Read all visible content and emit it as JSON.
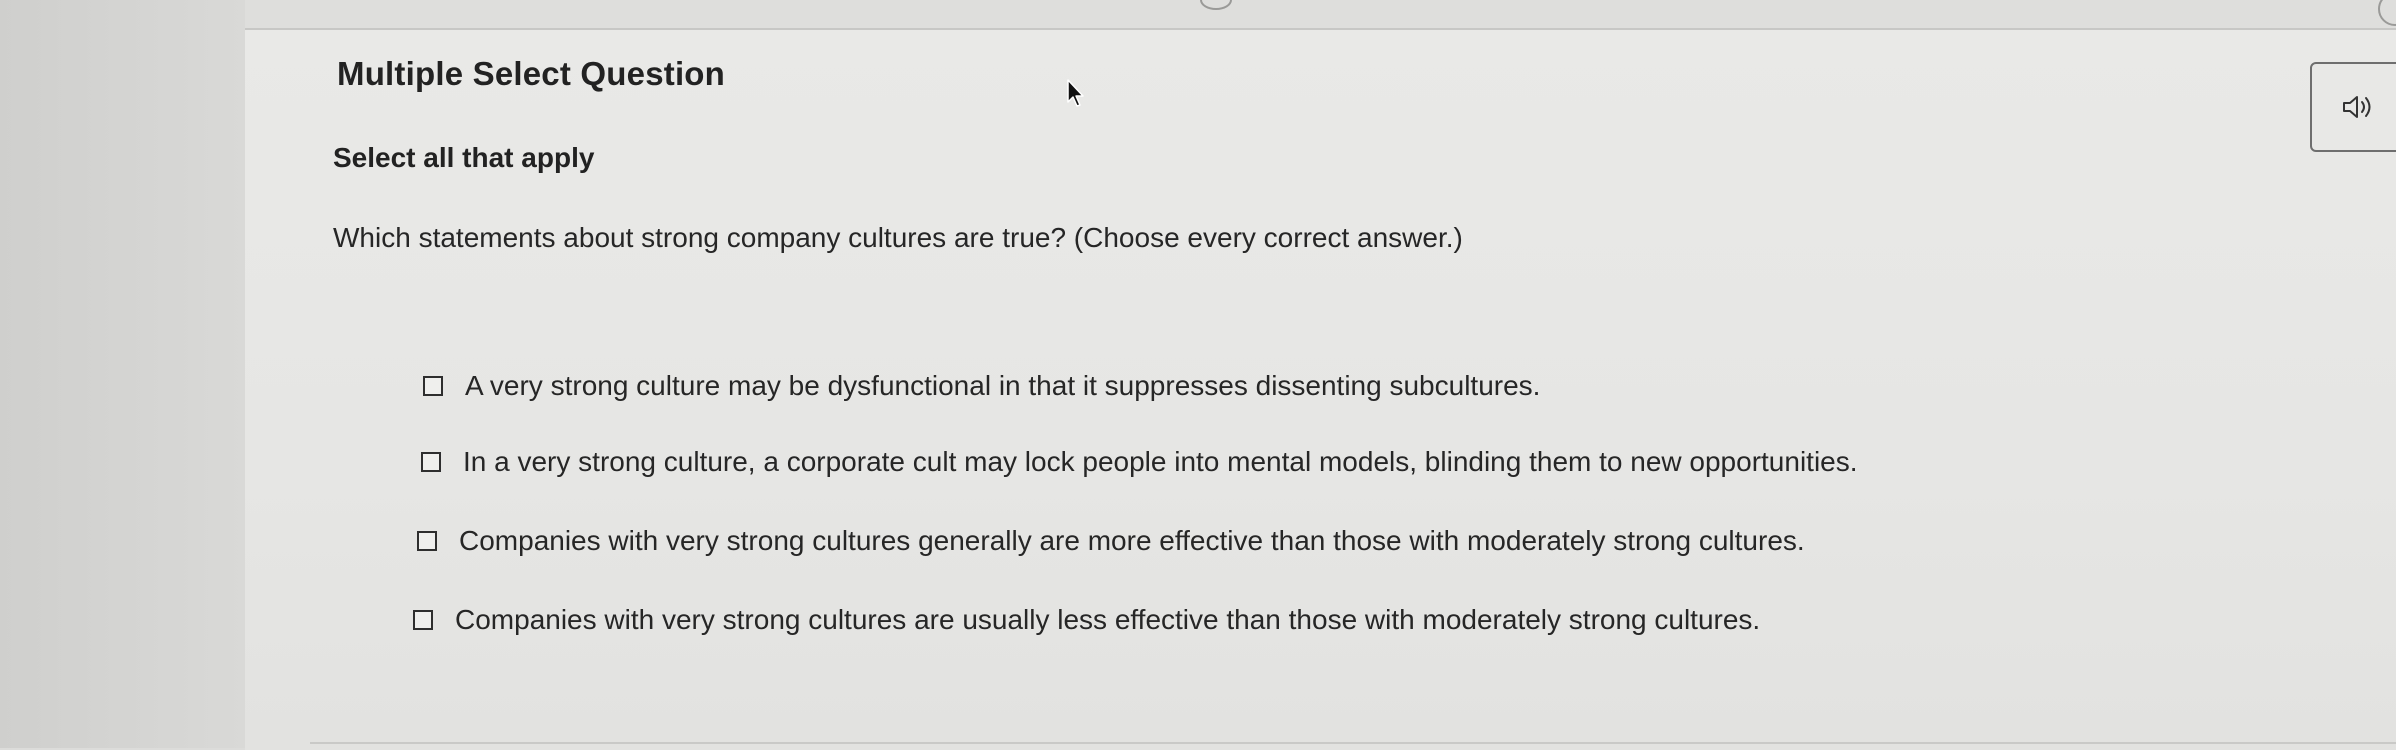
{
  "question": {
    "type_label": "Multiple Select Question",
    "instruction": "Select all that apply",
    "prompt": "Which statements about strong company cultures are true? (Choose every correct answer.)"
  },
  "options": [
    {
      "label": "A very strong culture may be dysfunctional in that it suppresses dissenting subcultures.",
      "checked": false
    },
    {
      "label": "In a very strong culture, a corporate cult may lock people into mental models, blinding them to new opportunities.",
      "checked": false
    },
    {
      "label": "Companies with very strong cultures generally are more effective than those with moderately strong cultures.",
      "checked": false
    },
    {
      "label": "Companies with very strong cultures are usually less effective than those with moderately strong cultures.",
      "checked": false
    }
  ],
  "audio": {
    "icon": "speaker-icon"
  },
  "cursor": {
    "icon": "mouse-pointer-icon"
  }
}
